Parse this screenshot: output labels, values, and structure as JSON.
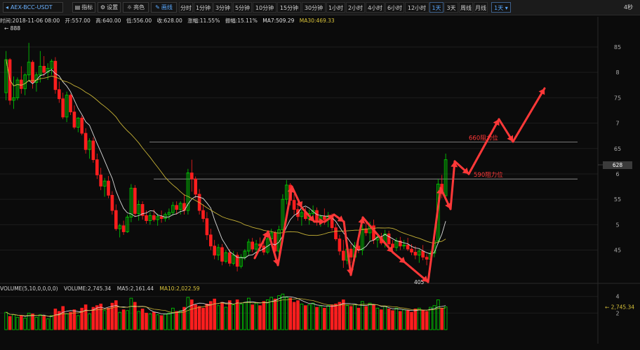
{
  "toolbar": {
    "symbol": "AEX-BCC-USDT",
    "buttons": [
      {
        "name": "indicator-button",
        "icon": "bars-icon",
        "label": "指标",
        "x": 103,
        "w": 33
      },
      {
        "name": "settings-button",
        "icon": "gear-icon",
        "label": "设置",
        "x": 139,
        "w": 33
      },
      {
        "name": "theme-button",
        "icon": "sun-icon",
        "label": "亮色",
        "x": 175,
        "w": 37
      },
      {
        "name": "draw-button",
        "icon": "pencil-icon",
        "label": "画线",
        "x": 215,
        "w": 37,
        "active": true
      }
    ],
    "timeframes": [
      "分时",
      "1分钟",
      "3分钟",
      "5分钟",
      "10分钟",
      "15分钟",
      "30分钟",
      "1小时",
      "2小时",
      "4小时",
      "6小时",
      "12小时",
      "1天",
      "3天",
      "周线",
      "月线"
    ],
    "active_timeframe": "1天",
    "dropdown_label": "1天 ▾",
    "refresh": "4秒"
  },
  "info": {
    "time": "时间:2018-11-06 08:00",
    "open": "开:557.00",
    "high": "高:640.00",
    "low": "低:556.00",
    "close": "收:628.00",
    "change": "涨幅:11.55%",
    "amplitude": "振幅:15.11%",
    "ma7": "MA7:509.29",
    "ma30": "MA30:469.33"
  },
  "volume_info": {
    "title": "VOLUME(5,10,0,0,0,0)",
    "volume": "VOLUME:2,745.34",
    "ma5": "MA5:2,161.44",
    "ma10": "MA10:2,022.59"
  },
  "price_box": "628",
  "high_marker": "← 888",
  "low_marker": "405",
  "colors": {
    "up": "#00d400",
    "down": "#ff1e1e",
    "ma_fast": "#d9d9d9",
    "ma_slow": "#c7b236",
    "annot": "#ff3838"
  },
  "chart_data": {
    "type": "candlestick",
    "price_axis": {
      "ticks": [
        "85",
        "8",
        "75",
        "7",
        "65",
        "6",
        "55",
        "5",
        "45"
      ],
      "scale_note": "labels shown in hundreds (e.g. 6 = 600)",
      "ylim": [
        390,
        890
      ]
    },
    "volume_axis": {
      "ticks": [
        "4",
        "2"
      ],
      "ylim": [
        0,
        4400
      ]
    },
    "candles": [
      [
        760,
        842,
        745,
        825
      ],
      [
        825,
        828,
        736,
        745
      ],
      [
        745,
        792,
        728,
        750
      ],
      [
        750,
        790,
        745,
        785
      ],
      [
        785,
        812,
        758,
        768
      ],
      [
        768,
        798,
        755,
        795
      ],
      [
        795,
        858,
        782,
        820
      ],
      [
        820,
        824,
        768,
        780
      ],
      [
        780,
        800,
        762,
        795
      ],
      [
        795,
        842,
        780,
        812
      ],
      [
        812,
        832,
        792,
        800
      ],
      [
        800,
        818,
        785,
        808
      ],
      [
        808,
        826,
        795,
        822
      ],
      [
        822,
        830,
        758,
        766
      ],
      [
        766,
        782,
        740,
        748
      ],
      [
        748,
        760,
        708,
        712
      ],
      [
        712,
        762,
        702,
        755
      ],
      [
        755,
        758,
        716,
        722
      ],
      [
        722,
        735,
        688,
        692
      ],
      [
        692,
        712,
        682,
        710
      ],
      [
        710,
        715,
        676,
        680
      ],
      [
        680,
        690,
        640,
        648
      ],
      [
        648,
        670,
        630,
        665
      ],
      [
        665,
        672,
        622,
        628
      ],
      [
        628,
        640,
        590,
        598
      ],
      [
        598,
        612,
        568,
        576
      ],
      [
        576,
        592,
        555,
        586
      ],
      [
        586,
        596,
        552,
        558
      ],
      [
        558,
        566,
        520,
        528
      ],
      [
        528,
        540,
        488,
        492
      ],
      [
        492,
        502,
        475,
        498
      ],
      [
        498,
        508,
        480,
        486
      ],
      [
        486,
        520,
        484,
        515
      ],
      [
        515,
        580,
        505,
        572
      ],
      [
        572,
        578,
        515,
        522
      ],
      [
        522,
        548,
        508,
        540
      ],
      [
        540,
        546,
        510,
        518
      ],
      [
        518,
        528,
        502,
        508
      ],
      [
        508,
        525,
        500,
        518
      ],
      [
        518,
        530,
        506,
        510
      ],
      [
        510,
        522,
        498,
        516
      ],
      [
        516,
        528,
        504,
        512
      ],
      [
        512,
        524,
        506,
        520
      ],
      [
        520,
        532,
        510,
        524
      ],
      [
        524,
        545,
        518,
        538
      ],
      [
        538,
        546,
        520,
        530
      ],
      [
        530,
        546,
        520,
        542
      ],
      [
        542,
        560,
        520,
        528
      ],
      [
        528,
        610,
        520,
        602
      ],
      [
        602,
        628,
        565,
        590
      ],
      [
        590,
        595,
        552,
        560
      ],
      [
        560,
        570,
        520,
        528
      ],
      [
        528,
        540,
        505,
        512
      ],
      [
        512,
        525,
        470,
        480
      ],
      [
        480,
        492,
        450,
        458
      ],
      [
        458,
        470,
        432,
        440
      ],
      [
        440,
        462,
        430,
        455
      ],
      [
        455,
        462,
        420,
        428
      ],
      [
        428,
        450,
        424,
        445
      ],
      [
        445,
        452,
        418,
        424
      ],
      [
        424,
        448,
        420,
        440
      ],
      [
        440,
        446,
        408,
        418
      ],
      [
        418,
        442,
        414,
        436
      ],
      [
        436,
        452,
        430,
        448
      ],
      [
        448,
        472,
        440,
        466
      ],
      [
        466,
        474,
        446,
        452
      ],
      [
        452,
        470,
        440,
        462
      ],
      [
        462,
        475,
        450,
        458
      ],
      [
        458,
        470,
        440,
        446
      ],
      [
        446,
        480,
        442,
        472
      ],
      [
        472,
        492,
        462,
        484
      ],
      [
        484,
        488,
        438,
        448
      ],
      [
        448,
        498,
        440,
        490
      ],
      [
        490,
        560,
        482,
        550
      ],
      [
        550,
        588,
        540,
        578
      ],
      [
        578,
        582,
        538,
        548
      ],
      [
        548,
        560,
        520,
        530
      ],
      [
        530,
        545,
        508,
        516
      ],
      [
        516,
        530,
        498,
        524
      ],
      [
        524,
        535,
        508,
        512
      ],
      [
        512,
        530,
        500,
        522
      ],
      [
        522,
        538,
        505,
        528
      ],
      [
        528,
        534,
        498,
        508
      ],
      [
        508,
        520,
        496,
        516
      ],
      [
        516,
        532,
        500,
        510
      ],
      [
        510,
        525,
        495,
        518
      ],
      [
        518,
        522,
        488,
        494
      ],
      [
        494,
        502,
        468,
        472
      ],
      [
        472,
        480,
        440,
        448
      ],
      [
        448,
        470,
        415,
        430
      ],
      [
        430,
        460,
        422,
        452
      ],
      [
        452,
        462,
        424,
        436
      ],
      [
        436,
        466,
        428,
        458
      ],
      [
        458,
        474,
        444,
        450
      ],
      [
        450,
        500,
        440,
        492
      ],
      [
        492,
        508,
        478,
        484
      ],
      [
        484,
        506,
        466,
        498
      ],
      [
        498,
        510,
        462,
        470
      ],
      [
        470,
        482,
        455,
        476
      ],
      [
        476,
        484,
        460,
        464
      ],
      [
        464,
        490,
        455,
        482
      ],
      [
        482,
        488,
        456,
        462
      ],
      [
        462,
        470,
        448,
        455
      ],
      [
        455,
        474,
        448,
        468
      ],
      [
        468,
        476,
        450,
        458
      ],
      [
        458,
        470,
        452,
        460
      ],
      [
        460,
        474,
        448,
        452
      ],
      [
        452,
        462,
        440,
        446
      ],
      [
        446,
        458,
        432,
        440
      ],
      [
        440,
        452,
        425,
        448
      ],
      [
        448,
        460,
        430,
        436
      ],
      [
        436,
        442,
        420,
        432
      ],
      [
        432,
        448,
        412,
        444
      ],
      [
        444,
        474,
        436,
        468
      ],
      [
        468,
        590,
        462,
        580
      ],
      [
        580,
        598,
        552,
        562
      ],
      [
        557,
        640,
        556,
        628
      ]
    ],
    "volumes": [
      [
        2100,
        0
      ],
      [
        1600,
        1
      ],
      [
        1800,
        0
      ],
      [
        1500,
        0
      ],
      [
        1700,
        1
      ],
      [
        1400,
        0
      ],
      [
        2000,
        0
      ],
      [
        1900,
        1
      ],
      [
        1500,
        0
      ],
      [
        1800,
        0
      ],
      [
        1600,
        1
      ],
      [
        1300,
        0
      ],
      [
        1700,
        0
      ],
      [
        2500,
        1
      ],
      [
        2200,
        1
      ],
      [
        2800,
        1
      ],
      [
        1900,
        0
      ],
      [
        2100,
        1
      ],
      [
        2400,
        1
      ],
      [
        1700,
        0
      ],
      [
        2600,
        1
      ],
      [
        3000,
        1
      ],
      [
        1900,
        0
      ],
      [
        2700,
        1
      ],
      [
        2900,
        1
      ],
      [
        3100,
        1
      ],
      [
        2300,
        0
      ],
      [
        2600,
        1
      ],
      [
        3200,
        1
      ],
      [
        3500,
        1
      ],
      [
        2100,
        0
      ],
      [
        2400,
        1
      ],
      [
        2300,
        0
      ],
      [
        3800,
        0
      ],
      [
        3300,
        1
      ],
      [
        2200,
        0
      ],
      [
        2500,
        1
      ],
      [
        2000,
        1
      ],
      [
        1900,
        0
      ],
      [
        2100,
        1
      ],
      [
        1800,
        0
      ],
      [
        1700,
        1
      ],
      [
        1900,
        0
      ],
      [
        2000,
        0
      ],
      [
        2600,
        0
      ],
      [
        2200,
        1
      ],
      [
        2300,
        0
      ],
      [
        2700,
        1
      ],
      [
        3900,
        0
      ],
      [
        3600,
        1
      ],
      [
        3000,
        1
      ],
      [
        2800,
        1
      ],
      [
        2600,
        1
      ],
      [
        3100,
        1
      ],
      [
        3400,
        1
      ],
      [
        3700,
        1
      ],
      [
        2900,
        0
      ],
      [
        3300,
        1
      ],
      [
        2700,
        0
      ],
      [
        3500,
        1
      ],
      [
        3000,
        0
      ],
      [
        3600,
        1
      ],
      [
        3100,
        0
      ],
      [
        3300,
        0
      ],
      [
        3800,
        0
      ],
      [
        3000,
        1
      ],
      [
        3200,
        0
      ],
      [
        2900,
        1
      ],
      [
        3400,
        1
      ],
      [
        3600,
        0
      ],
      [
        3900,
        0
      ],
      [
        3700,
        1
      ],
      [
        4100,
        0
      ],
      [
        4300,
        0
      ],
      [
        3900,
        0
      ],
      [
        3800,
        1
      ],
      [
        3300,
        1
      ],
      [
        3500,
        1
      ],
      [
        3100,
        0
      ],
      [
        2900,
        1
      ],
      [
        3000,
        0
      ],
      [
        3200,
        0
      ],
      [
        2700,
        1
      ],
      [
        2800,
        0
      ],
      [
        2600,
        1
      ],
      [
        2900,
        0
      ],
      [
        3000,
        1
      ],
      [
        3100,
        1
      ],
      [
        3300,
        1
      ],
      [
        3600,
        1
      ],
      [
        2900,
        0
      ],
      [
        2800,
        1
      ],
      [
        3000,
        0
      ],
      [
        2600,
        1
      ],
      [
        3400,
        0
      ],
      [
        2800,
        1
      ],
      [
        3200,
        0
      ],
      [
        3000,
        1
      ],
      [
        2600,
        0
      ],
      [
        2400,
        1
      ],
      [
        2800,
        0
      ],
      [
        2500,
        1
      ],
      [
        2300,
        1
      ],
      [
        2600,
        0
      ],
      [
        2200,
        1
      ],
      [
        2400,
        0
      ],
      [
        2300,
        1
      ],
      [
        2100,
        1
      ],
      [
        2500,
        1
      ],
      [
        2600,
        0
      ],
      [
        2300,
        1
      ],
      [
        2200,
        1
      ],
      [
        2700,
        0
      ],
      [
        2900,
        0
      ],
      [
        3600,
        0
      ],
      [
        2600,
        1
      ],
      [
        2745,
        0
      ]
    ],
    "resistance_levels": [
      {
        "label": "660阻力位",
        "value": 663
      },
      {
        "label": "590阻力位",
        "value": 590
      }
    ]
  }
}
